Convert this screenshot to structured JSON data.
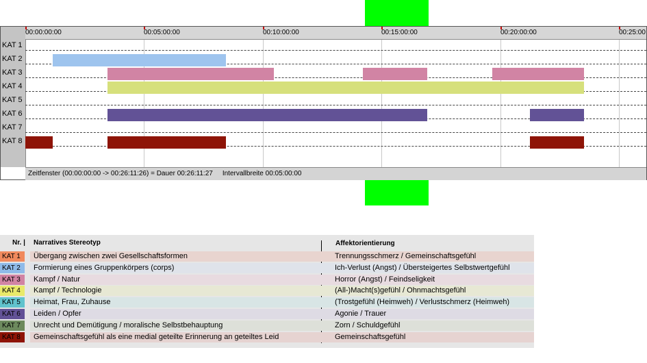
{
  "timeline": {
    "duration_seconds": 1571,
    "tick_interval_seconds": 300,
    "ticks": [
      "00:00:00:00",
      "00:05:00:00",
      "00:10:00:00",
      "00:15:00:00",
      "00:20:00:00",
      "00:25:00"
    ],
    "rows": [
      "KAT 1",
      "KAT 2",
      "KAT 3",
      "KAT 4",
      "KAT 5",
      "KAT 6",
      "KAT 7",
      "KAT 8"
    ],
    "colors": {
      "KAT 2": "#9ec4ee",
      "KAT 3": "#d184a4",
      "KAT 4": "#d6e07c",
      "KAT 6": "#625296",
      "KAT 8": "#8e1407"
    },
    "segments": [
      {
        "row": 1,
        "start": 69,
        "end": 507
      },
      {
        "row": 2,
        "start": 208,
        "end": 628
      },
      {
        "row": 2,
        "start": 853,
        "end": 1015
      },
      {
        "row": 2,
        "start": 1180,
        "end": 1412
      },
      {
        "row": 3,
        "start": 208,
        "end": 1412
      },
      {
        "row": 5,
        "start": 208,
        "end": 1015
      },
      {
        "row": 5,
        "start": 1275,
        "end": 1412
      },
      {
        "row": 7,
        "start": 0,
        "end": 69
      },
      {
        "row": 7,
        "start": 208,
        "end": 507
      },
      {
        "row": 7,
        "start": 1275,
        "end": 1412
      }
    ],
    "footer": {
      "window": "Zeitfenster (00:00:00:00 -> 00:26:11:26) = Dauer 00:26:11:27",
      "interval": "Intervallbreite 00:05:00:00"
    }
  },
  "legend": {
    "header_nr": "Nr. |",
    "header_stereotype": "Narratives Stereotyp",
    "header_affect": "Affektorientierung",
    "rows": [
      {
        "kat": "KAT 1",
        "stereotype": "Übergang zwischen zwei Gesellschaftsformen",
        "affect": "Trennungsschmerz / Gemeinschaftsgefühl",
        "color": "#f08a5d",
        "tint": "#e8d4cf"
      },
      {
        "kat": "KAT 2",
        "stereotype": "Formierung eines Gruppenkörpers (corps)",
        "affect": "Ich-Verlust (Angst) / Übersteigertes Selbstwertgefühl",
        "color": "#8fbbe9",
        "tint": "#dfe3ea"
      },
      {
        "kat": "KAT 3",
        "stereotype": "Kampf / Natur",
        "affect": "Horror (Angst) / Feindseligkeit",
        "color": "#d184a4",
        "tint": "#e8dbe0"
      },
      {
        "kat": "KAT 4",
        "stereotype": "Kampf / Technologie",
        "affect": "(All-)Macht(s)gefühl / Ohnmachtsgefühl",
        "color": "#e9ea6a",
        "tint": "#e7e8d4"
      },
      {
        "kat": "KAT 5",
        "stereotype": "Heimat, Frau, Zuhause",
        "affect": "(Trostgefühl (Heimweh) / Verlustschmerz (Heimweh)",
        "color": "#61c3cd",
        "tint": "#d8e5e5"
      },
      {
        "kat": "KAT 6",
        "stereotype": "Leiden / Opfer",
        "affect": "Agonie / Trauer",
        "color": "#625296",
        "tint": "#dedbe4"
      },
      {
        "kat": "KAT 7",
        "stereotype": "Unrecht und Demütigung / moralische Selbstbehauptung",
        "affect": "Zorn / Schuldgefühl",
        "color": "#6d8a5e",
        "tint": "#dde0d9"
      },
      {
        "kat": "KAT 8",
        "stereotype": "Gemeinschaftsgefühl als eine medial geteilte Erinnerung an geteiltes Leid",
        "affect": "Gemeinschaftsgefühl",
        "color": "#8e1407",
        "tint": "#e6d3d1"
      }
    ]
  }
}
